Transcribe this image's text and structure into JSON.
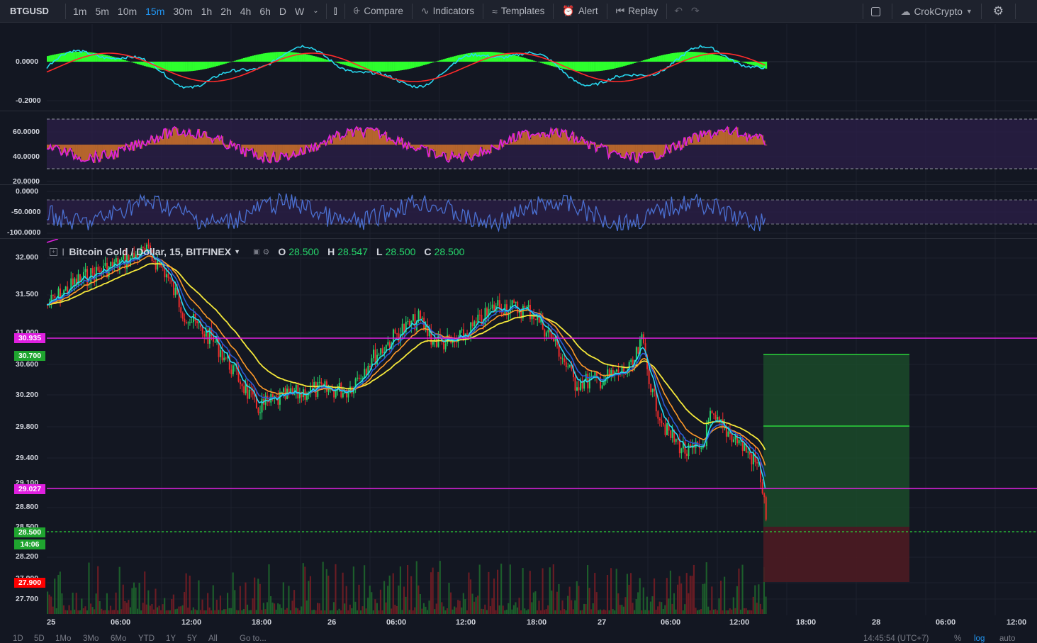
{
  "toolbar": {
    "symbol": "BTGUSD",
    "intervals": [
      "1m",
      "5m",
      "10m",
      "15m",
      "30m",
      "1h",
      "2h",
      "4h",
      "6h",
      "D",
      "W"
    ],
    "active_interval": "15m",
    "compare": "Compare",
    "indicators": "Indicators",
    "templates": "Templates",
    "alert": "Alert",
    "replay": "Replay",
    "user": "CrokCrypto"
  },
  "legend": {
    "title": "Bitcoin Gold / Dollar, 15, BITFINEX",
    "o_label": "O",
    "o": "28.500",
    "h_label": "H",
    "h": "28.547",
    "l_label": "L",
    "l": "28.500",
    "c_label": "C",
    "c": "28.500"
  },
  "macd_axis": [
    "0.0000",
    "-0.2000"
  ],
  "rsi_axis": [
    "60.0000",
    "40.0000",
    "20.0000"
  ],
  "wr_axis": [
    "0.0000",
    "-50.0000",
    "-100.0000"
  ],
  "price_axis": [
    "32.000",
    "31.500",
    "31.000",
    "30.600",
    "30.200",
    "29.800",
    "29.400",
    "29.100",
    "28.800",
    "28.500",
    "28.200",
    "27.900",
    "27.700"
  ],
  "price_tags": {
    "upper_line": "30.935",
    "target": "30.700",
    "lower_line": "29.027",
    "last": "28.500",
    "countdown": "14:06",
    "stop": "27.900"
  },
  "x_axis": [
    "25",
    "06:00",
    "12:00",
    "18:00",
    "26",
    "06:00",
    "12:00",
    "18:00",
    "27",
    "06:00",
    "12:00",
    "18:00",
    "28",
    "06:00",
    "12:00"
  ],
  "bottom": {
    "ranges": [
      "1D",
      "5D",
      "1Mo",
      "3Mo",
      "6Mo",
      "YTD",
      "1Y",
      "5Y",
      "All"
    ],
    "goto": "Go to...",
    "time": "14:45:54 (UTC+7)",
    "percent": "%",
    "log": "log",
    "auto": "auto"
  },
  "colors": {
    "background": "#131722",
    "up": "#26d66b",
    "down": "#ef2b2b",
    "magenta": "#e020e0",
    "ema_yellow": "#f5e83a",
    "ema_orange": "#ff9a2a",
    "ema_blue": "#2a5bd7",
    "ema_cyan": "#27d8f0",
    "macd_hist": "#2dff2d",
    "rsi_fill": "#b5652c",
    "wr_line": "#4a6fd0",
    "target_zone": "#1b4d2a",
    "stop_zone": "#4d1b22"
  },
  "icons": [
    "bar-style-icon",
    "compare-icon",
    "indicators-icon",
    "templates-icon",
    "alert-icon",
    "replay-icon",
    "undo-icon",
    "redo-icon",
    "fullscreen-icon",
    "cloud-icon",
    "settings-icon"
  ]
}
